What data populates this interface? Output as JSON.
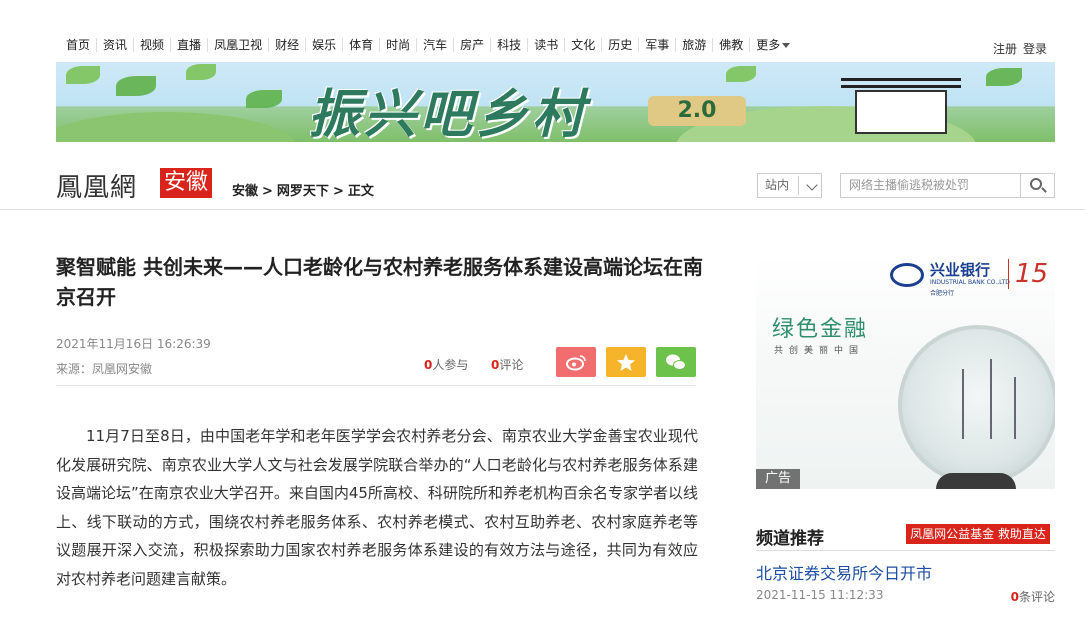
{
  "nav": {
    "items": [
      "首页",
      "资讯",
      "视频",
      "直播",
      "凤凰卫视",
      "财经",
      "娱乐",
      "体育",
      "时尚",
      "汽车",
      "房产",
      "科技",
      "读书",
      "文化",
      "历史",
      "军事",
      "旅游",
      "佛教",
      "更多"
    ],
    "login": "注册",
    "register": "登录"
  },
  "banner": {
    "title": "振兴吧乡村",
    "version": "2.0"
  },
  "header": {
    "logo": "鳳凰網",
    "region": "安徽",
    "breadcrumb": [
      "安徽",
      "网罗天下",
      "正文"
    ],
    "breadcrumb_sep": ">",
    "search_scope": "站内",
    "search_placeholder": "网络主播偷逃税被处罚"
  },
  "article": {
    "title": "聚智赋能 共创未来——人口老龄化与农村养老服务体系建设高端论坛在南京召开",
    "date": "2021年11月16日 16:26:39",
    "source": "来源：凤凰网安徽",
    "participants_num": "0",
    "participants_label": "人参与",
    "comments_num": "0",
    "comments_label": "评论",
    "body": "11月7日至8日，由中国老年学和老年医学学会农村养老分会、南京农业大学金善宝农业现代化发展研究院、南京农业大学人文与社会发展学院联合举办的“人口老龄化与农村养老服务体系建设高端论坛”在南京农业大学召开。来自国内45所高校、科研院所和养老机构百余名专家学者以线上、线下联动的方式，围绕农村养老服务体系、农村养老模式、农村互助养老、农村家庭养老等议题展开深入交流，积极探索助力国家农村养老服务体系建设的有效方法与途径，共同为有效应对农村养老问题建言献策。"
  },
  "ad": {
    "bank_name": "兴业银行",
    "bank_en": "INDUSTRIAL BANK CO.,LTD",
    "bank_branch": "合肥分行",
    "anniversary": "15",
    "slogan": "绿色金融",
    "subslogan": "共创美丽中国",
    "label": "广告"
  },
  "recommend": {
    "title": "频道推荐",
    "tag": "凤凰网公益基金 救助直达",
    "headline": "北京证券交易所今日开市",
    "time": "2021-11-15 11:12:33",
    "comments_num": "0",
    "comments_label": "条评论"
  },
  "colors": {
    "accent_red": "#d9241b",
    "link_blue": "#1d4ea1",
    "weibo": "#f26d6d",
    "favorite": "#f5b42a",
    "wechat": "#6cc24a"
  },
  "icons": {
    "share_weibo": "weibo-icon",
    "share_favorite": "star-icon",
    "share_wechat": "wechat-icon",
    "search": "search-icon"
  }
}
